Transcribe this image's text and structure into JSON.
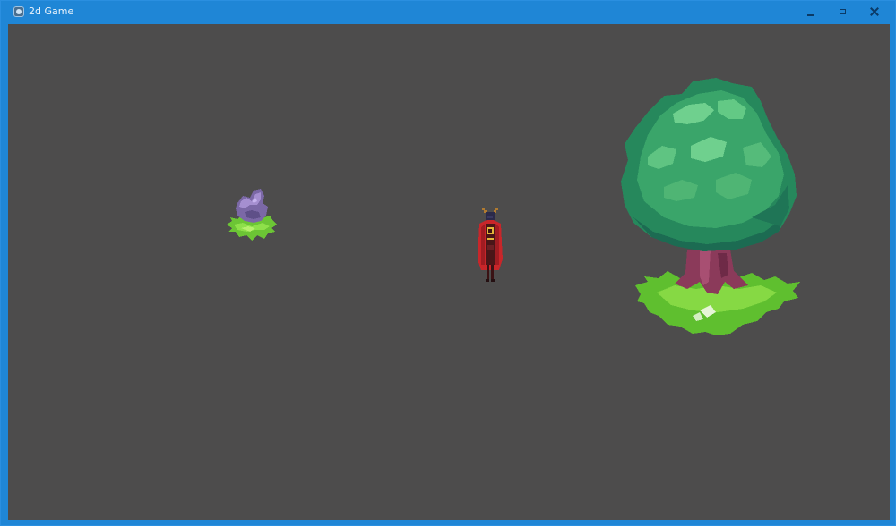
{
  "window": {
    "title": "2d Game",
    "icon": "app-icon",
    "buttons": {
      "minimize": "minimize-icon",
      "maximize": "maximize-icon",
      "close": "close-icon"
    }
  },
  "colors": {
    "titlebar": "#1f86d6",
    "viewport_background": "#4d4c4c",
    "grass": "#7bd13a",
    "rock": "#8a74b8",
    "foliage": "#2f9a66",
    "trunk": "#8b3a5a",
    "cloak": "#c8262a"
  },
  "scene": {
    "objects": [
      "rock-sprite",
      "player-sprite",
      "tree-sprite"
    ]
  }
}
